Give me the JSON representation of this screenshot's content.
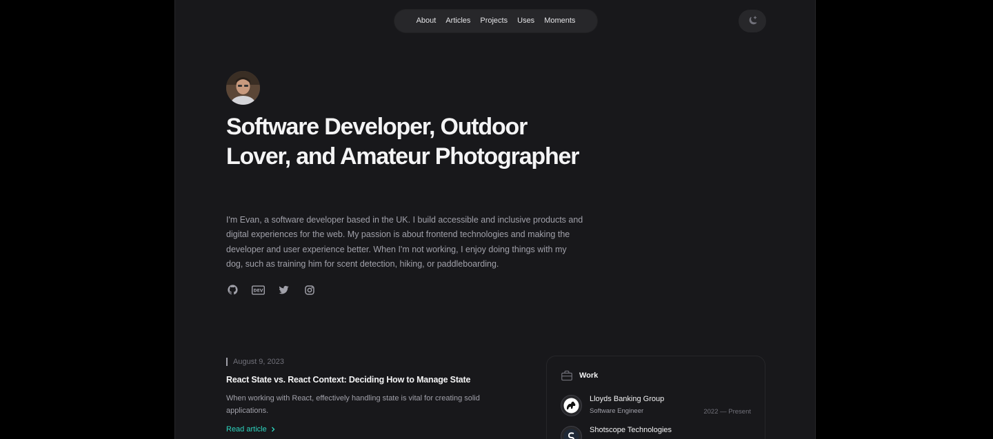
{
  "nav": {
    "items": [
      "About",
      "Articles",
      "Projects",
      "Uses",
      "Moments"
    ]
  },
  "hero": {
    "title": "Software Developer, Outdoor Lover, and Amateur Photographer",
    "intro": "I'm Evan, a software developer based in the UK. I build accessible and inclusive products and digital experiences for the web. My passion is about frontend technologies and making the developer and user experience better. When I'm not working, I enjoy doing things with my dog, such as training him for scent detection, hiking, or paddleboarding.",
    "socials": [
      "github-icon",
      "dev-icon",
      "twitter-icon",
      "instagram-icon"
    ]
  },
  "article": {
    "date": "August 9, 2023",
    "title": "React State vs. React Context: Deciding How to Manage State",
    "summary": "When working with React, effectively handling state is vital for creating solid applications.",
    "link_label": "Read article"
  },
  "work": {
    "heading": "Work",
    "jobs": [
      {
        "company": "Lloyds Banking Group",
        "role": "Software Engineer",
        "dates": "2022 — Present"
      },
      {
        "company": "Shotscope Technologies",
        "role": "",
        "dates": ""
      }
    ]
  },
  "colors": {
    "background": "#18181b",
    "accent": "#2dd4bf",
    "text_muted": "#a1a1aa"
  }
}
